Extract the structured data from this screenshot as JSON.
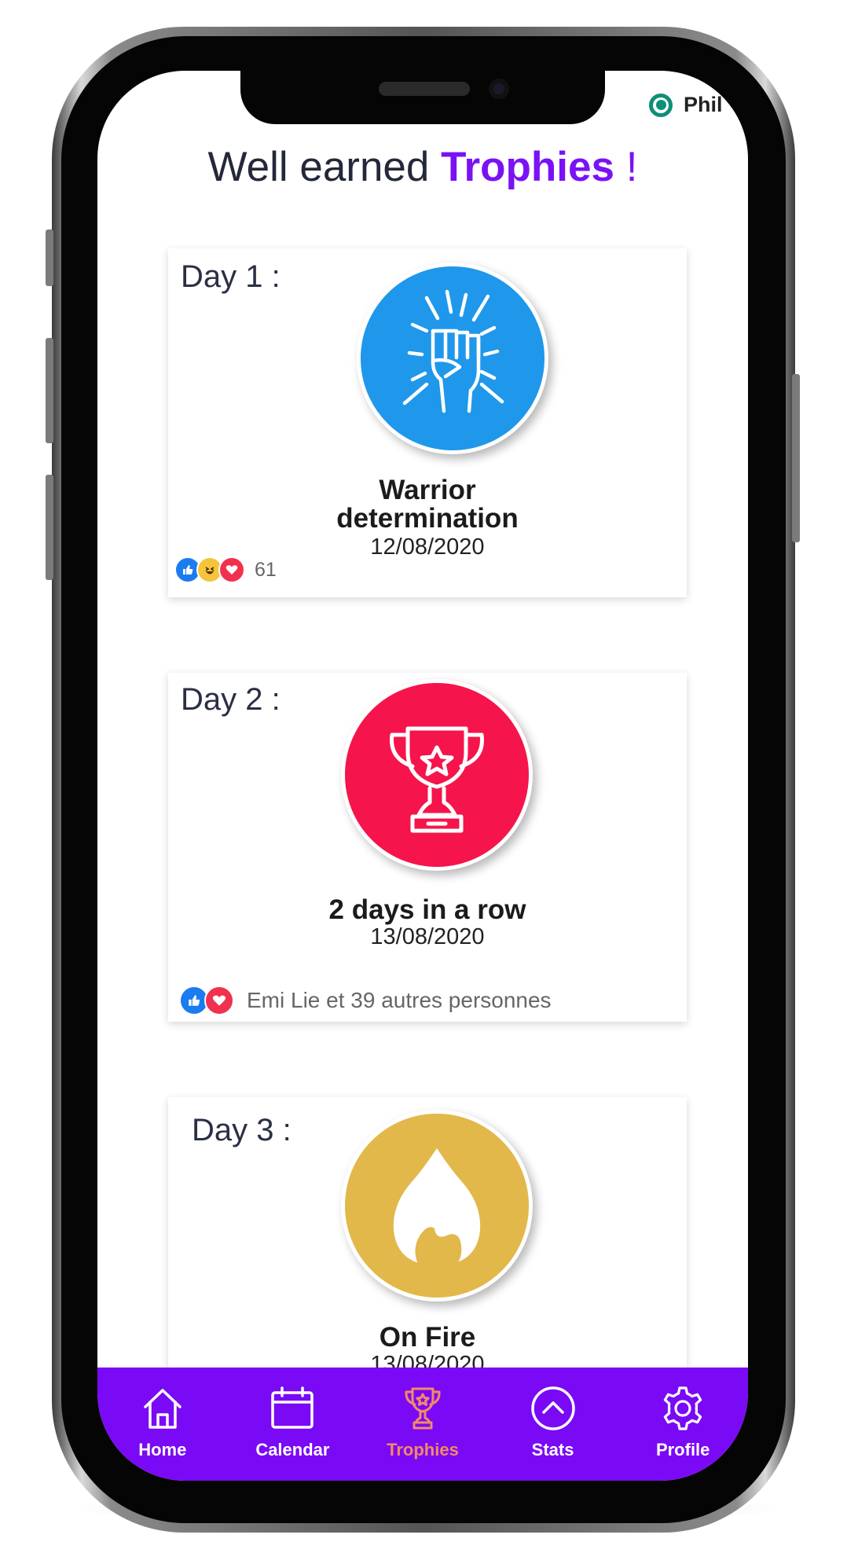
{
  "user": {
    "name": "Phil",
    "status_color": "#0e8f77"
  },
  "page": {
    "title_prefix": "Well earned ",
    "title_accent": "Trophies",
    "title_suffix": " !"
  },
  "trophies": [
    {
      "day": "Day 1 :",
      "name_line1": "Warrior",
      "name_line2": "determination",
      "date": "12/08/2020",
      "icon": "raised-fist-icon",
      "color": "#1f97eb",
      "reactions": [
        "like",
        "haha",
        "love"
      ],
      "reaction_text": "61"
    },
    {
      "day": "Day 2 :",
      "name": "2 days in a row",
      "date": "13/08/2020",
      "icon": "trophy-star-icon",
      "color": "#f5144b",
      "reactions": [
        "like",
        "love"
      ],
      "reaction_text": "Emi Lie et 39 autres personnes"
    },
    {
      "day": "Day 3 :",
      "name": "On Fire",
      "date": "13/08/2020",
      "icon": "flame-icon",
      "color": "#e2b84b"
    }
  ],
  "tabs": [
    {
      "label": "Home",
      "icon": "home-icon"
    },
    {
      "label": "Calendar",
      "icon": "calendar-icon"
    },
    {
      "label": "Trophies",
      "icon": "trophy-icon",
      "active": true
    },
    {
      "label": "Stats",
      "icon": "chevron-up-circle-icon"
    },
    {
      "label": "Profile",
      "icon": "gear-icon"
    }
  ],
  "colors": {
    "accent": "#7b11f5",
    "tabbar": "#7a09f6",
    "active_tab": "#f28b62"
  }
}
